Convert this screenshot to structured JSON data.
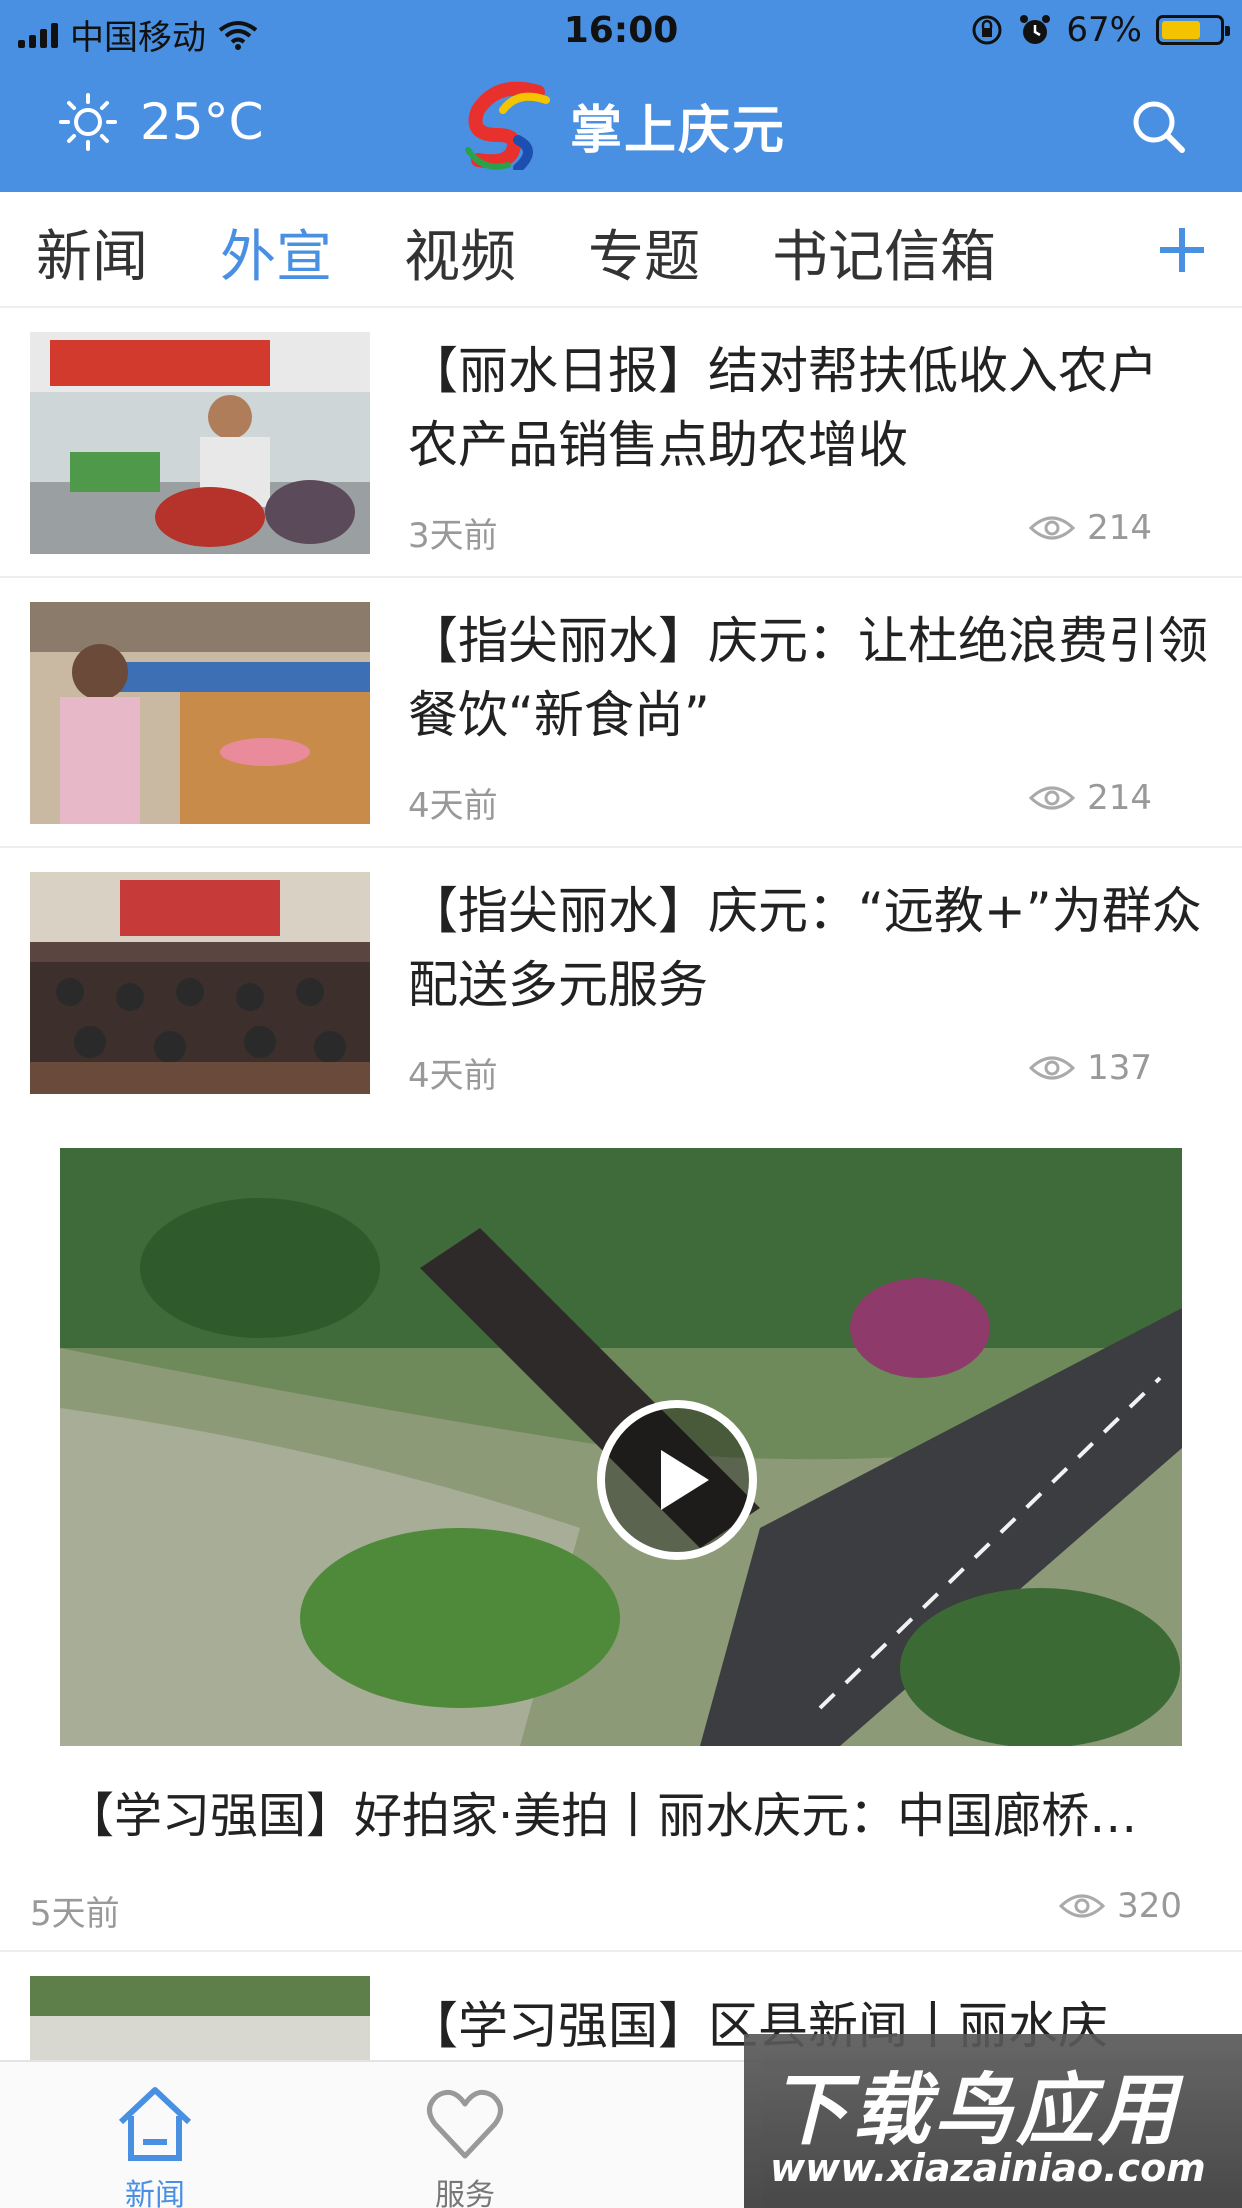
{
  "status_bar": {
    "carrier": "中国移动",
    "time": "16:00",
    "battery_percent": "67%",
    "battery_level": 0.67,
    "icons": [
      "signal-icon",
      "wifi-icon",
      "rotation-lock-icon",
      "alarm-icon",
      "battery-icon"
    ]
  },
  "header": {
    "temperature": "25°C",
    "weather_icon": "sun-icon",
    "app_title": "掌上庆元",
    "search_icon": "search-icon",
    "brand_color": "#4a90e2"
  },
  "tabs": [
    {
      "label": "新闻",
      "active": false
    },
    {
      "label": "外宣",
      "active": true
    },
    {
      "label": "视频",
      "active": false
    },
    {
      "label": "专题",
      "active": false
    },
    {
      "label": "书记信箱",
      "active": false
    }
  ],
  "news": [
    {
      "headline": "【丽水日报】结对帮扶低收入农户 农产品销售点助农增收",
      "time": "3天前",
      "views": "214"
    },
    {
      "headline": "【指尖丽水】庆元：让杜绝浪费引领餐饮“新食尚”",
      "time": "4天前",
      "views": "214"
    },
    {
      "headline": "【指尖丽水】庆元：“远教+”为群众配送多元服务",
      "time": "4天前",
      "views": "137"
    }
  ],
  "video": {
    "title": "【学习强国】好拍家·美拍丨丽水庆元：中国廊桥…",
    "time": "5天前",
    "views": "320"
  },
  "partial_news": {
    "headline": "【学习强国】区县新闻丨丽水庆"
  },
  "bottom_nav": [
    {
      "label": "新闻",
      "icon": "home-icon",
      "active": true
    },
    {
      "label": "服务",
      "icon": "heart-icon",
      "active": false
    }
  ],
  "watermark": {
    "main": "下载鸟应用",
    "url": "www.xiazainiao.com"
  }
}
